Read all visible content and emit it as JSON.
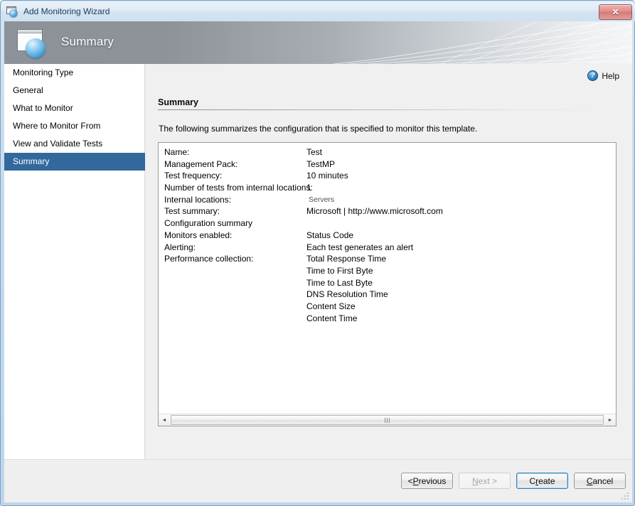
{
  "window": {
    "title": "Add Monitoring Wizard",
    "title_icon": "wizard-window-globe-icon",
    "close_label": "✕"
  },
  "banner": {
    "title": "Summary",
    "icon": "page-globe-icon"
  },
  "sidebar": {
    "items": [
      {
        "label": "Monitoring Type",
        "selected": false
      },
      {
        "label": "General",
        "selected": false
      },
      {
        "label": "What to Monitor",
        "selected": false
      },
      {
        "label": "Where to Monitor From",
        "selected": false
      },
      {
        "label": "View and Validate Tests",
        "selected": false
      },
      {
        "label": "Summary",
        "selected": true
      }
    ]
  },
  "content": {
    "help": {
      "label": "Help",
      "icon": "help-question-icon"
    },
    "heading": "Summary",
    "intro": "The following summarizes the configuration that is specified to monitor this template.",
    "summary_rows": [
      {
        "label": "Name:",
        "value": "Test",
        "muted": false
      },
      {
        "label": "Management Pack:",
        "value": "TestMP",
        "muted": false
      },
      {
        "label": "Test frequency:",
        "value": "10 minutes",
        "muted": false
      },
      {
        "label": "Number of tests from internal locations:",
        "value": "1",
        "muted": false
      },
      {
        "label": "Internal locations:",
        "value": "Servers",
        "muted": true
      },
      {
        "label": "Test summary:",
        "value": "Microsoft | http://www.microsoft.com",
        "muted": false
      },
      {
        "label": "Configuration summary",
        "value": "",
        "muted": false
      },
      {
        "label": "Monitors enabled:",
        "value": "Status Code",
        "muted": false
      },
      {
        "label": "Alerting:",
        "value": "Each test generates an alert",
        "muted": false
      },
      {
        "label": "Performance collection:",
        "value": "Total Response Time",
        "muted": false
      },
      {
        "label": "",
        "value": "Time to First Byte",
        "muted": false
      },
      {
        "label": "",
        "value": "Time to Last Byte",
        "muted": false
      },
      {
        "label": "",
        "value": "DNS Resolution Time",
        "muted": false
      },
      {
        "label": "",
        "value": "Content Size",
        "muted": false
      },
      {
        "label": "",
        "value": "Content Time",
        "muted": false
      }
    ],
    "scrollbar": {
      "left_arrow": "◄",
      "right_arrow": "►"
    }
  },
  "footer": {
    "buttons": [
      {
        "name": "previous-button",
        "pre": "< ",
        "mnemonic": "P",
        "post": "revious",
        "state": "enabled"
      },
      {
        "name": "next-button",
        "pre": "",
        "mnemonic": "N",
        "post": "ext >",
        "state": "disabled"
      },
      {
        "name": "create-button",
        "pre": "C",
        "mnemonic": "r",
        "post": "eate",
        "state": "default"
      },
      {
        "name": "cancel-button",
        "pre": "",
        "mnemonic": "C",
        "post": "ancel",
        "state": "enabled"
      }
    ]
  },
  "colors": {
    "selection_blue": "#31699c",
    "frame_blue": "#bed5ea",
    "content_bg": "#f0f0f0",
    "footer_bg": "#efefef",
    "accent_button_border": "#3c7fb1"
  }
}
